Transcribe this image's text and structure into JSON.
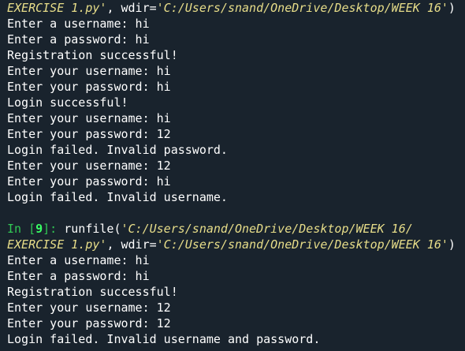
{
  "console": {
    "lines": [
      {
        "segments": [
          {
            "t": "EXERCISE 1.py'",
            "c": "str"
          },
          {
            "t": ", wdir=",
            "c": "plain"
          },
          {
            "t": "'C:/Users/snand/OneDrive/Desktop/WEEK 16'",
            "c": "str"
          },
          {
            "t": ")",
            "c": "plain"
          }
        ]
      },
      {
        "segments": [
          {
            "t": "Enter a username: hi",
            "c": "plain"
          }
        ]
      },
      {
        "segments": [
          {
            "t": "Enter a password: hi",
            "c": "plain"
          }
        ]
      },
      {
        "segments": [
          {
            "t": "Registration successful!",
            "c": "plain"
          }
        ]
      },
      {
        "segments": [
          {
            "t": "Enter your username: hi",
            "c": "plain"
          }
        ]
      },
      {
        "segments": [
          {
            "t": "Enter your password: hi",
            "c": "plain"
          }
        ]
      },
      {
        "segments": [
          {
            "t": "Login successful!",
            "c": "plain"
          }
        ]
      },
      {
        "segments": [
          {
            "t": "Enter your username: hi",
            "c": "plain"
          }
        ]
      },
      {
        "segments": [
          {
            "t": "Enter your password: 12",
            "c": "plain"
          }
        ]
      },
      {
        "segments": [
          {
            "t": "Login failed. Invalid password.",
            "c": "plain"
          }
        ]
      },
      {
        "segments": [
          {
            "t": "Enter your username: 12",
            "c": "plain"
          }
        ]
      },
      {
        "segments": [
          {
            "t": "Enter your password: hi",
            "c": "plain"
          }
        ]
      },
      {
        "segments": [
          {
            "t": "Login failed. Invalid username.",
            "c": "plain"
          }
        ]
      },
      {
        "segments": []
      },
      {
        "segments": [
          {
            "t": "In [",
            "c": "prompt-in"
          },
          {
            "t": "9",
            "c": "prompt-num"
          },
          {
            "t": "]: ",
            "c": "prompt-in"
          },
          {
            "t": "runfile(",
            "c": "plain"
          },
          {
            "t": "'C:/Users/snand/OneDrive/Desktop/WEEK 16/",
            "c": "str"
          }
        ]
      },
      {
        "segments": [
          {
            "t": "EXERCISE 1.py'",
            "c": "str"
          },
          {
            "t": ", wdir=",
            "c": "plain"
          },
          {
            "t": "'C:/Users/snand/OneDrive/Desktop/WEEK 16'",
            "c": "str"
          },
          {
            "t": ")",
            "c": "plain"
          }
        ]
      },
      {
        "segments": [
          {
            "t": "Enter a username: hi",
            "c": "plain"
          }
        ]
      },
      {
        "segments": [
          {
            "t": "Enter a password: hi",
            "c": "plain"
          }
        ]
      },
      {
        "segments": [
          {
            "t": "Registration successful!",
            "c": "plain"
          }
        ]
      },
      {
        "segments": [
          {
            "t": "Enter your username: 12",
            "c": "plain"
          }
        ]
      },
      {
        "segments": [
          {
            "t": "Enter your password: 12",
            "c": "plain"
          }
        ]
      },
      {
        "segments": [
          {
            "t": "Login failed. Invalid username and password.",
            "c": "plain"
          }
        ]
      }
    ]
  },
  "colors": {
    "background": "#19232d",
    "text": "#ffffff",
    "string": "#e7dd89",
    "prompt": "#31c754"
  }
}
